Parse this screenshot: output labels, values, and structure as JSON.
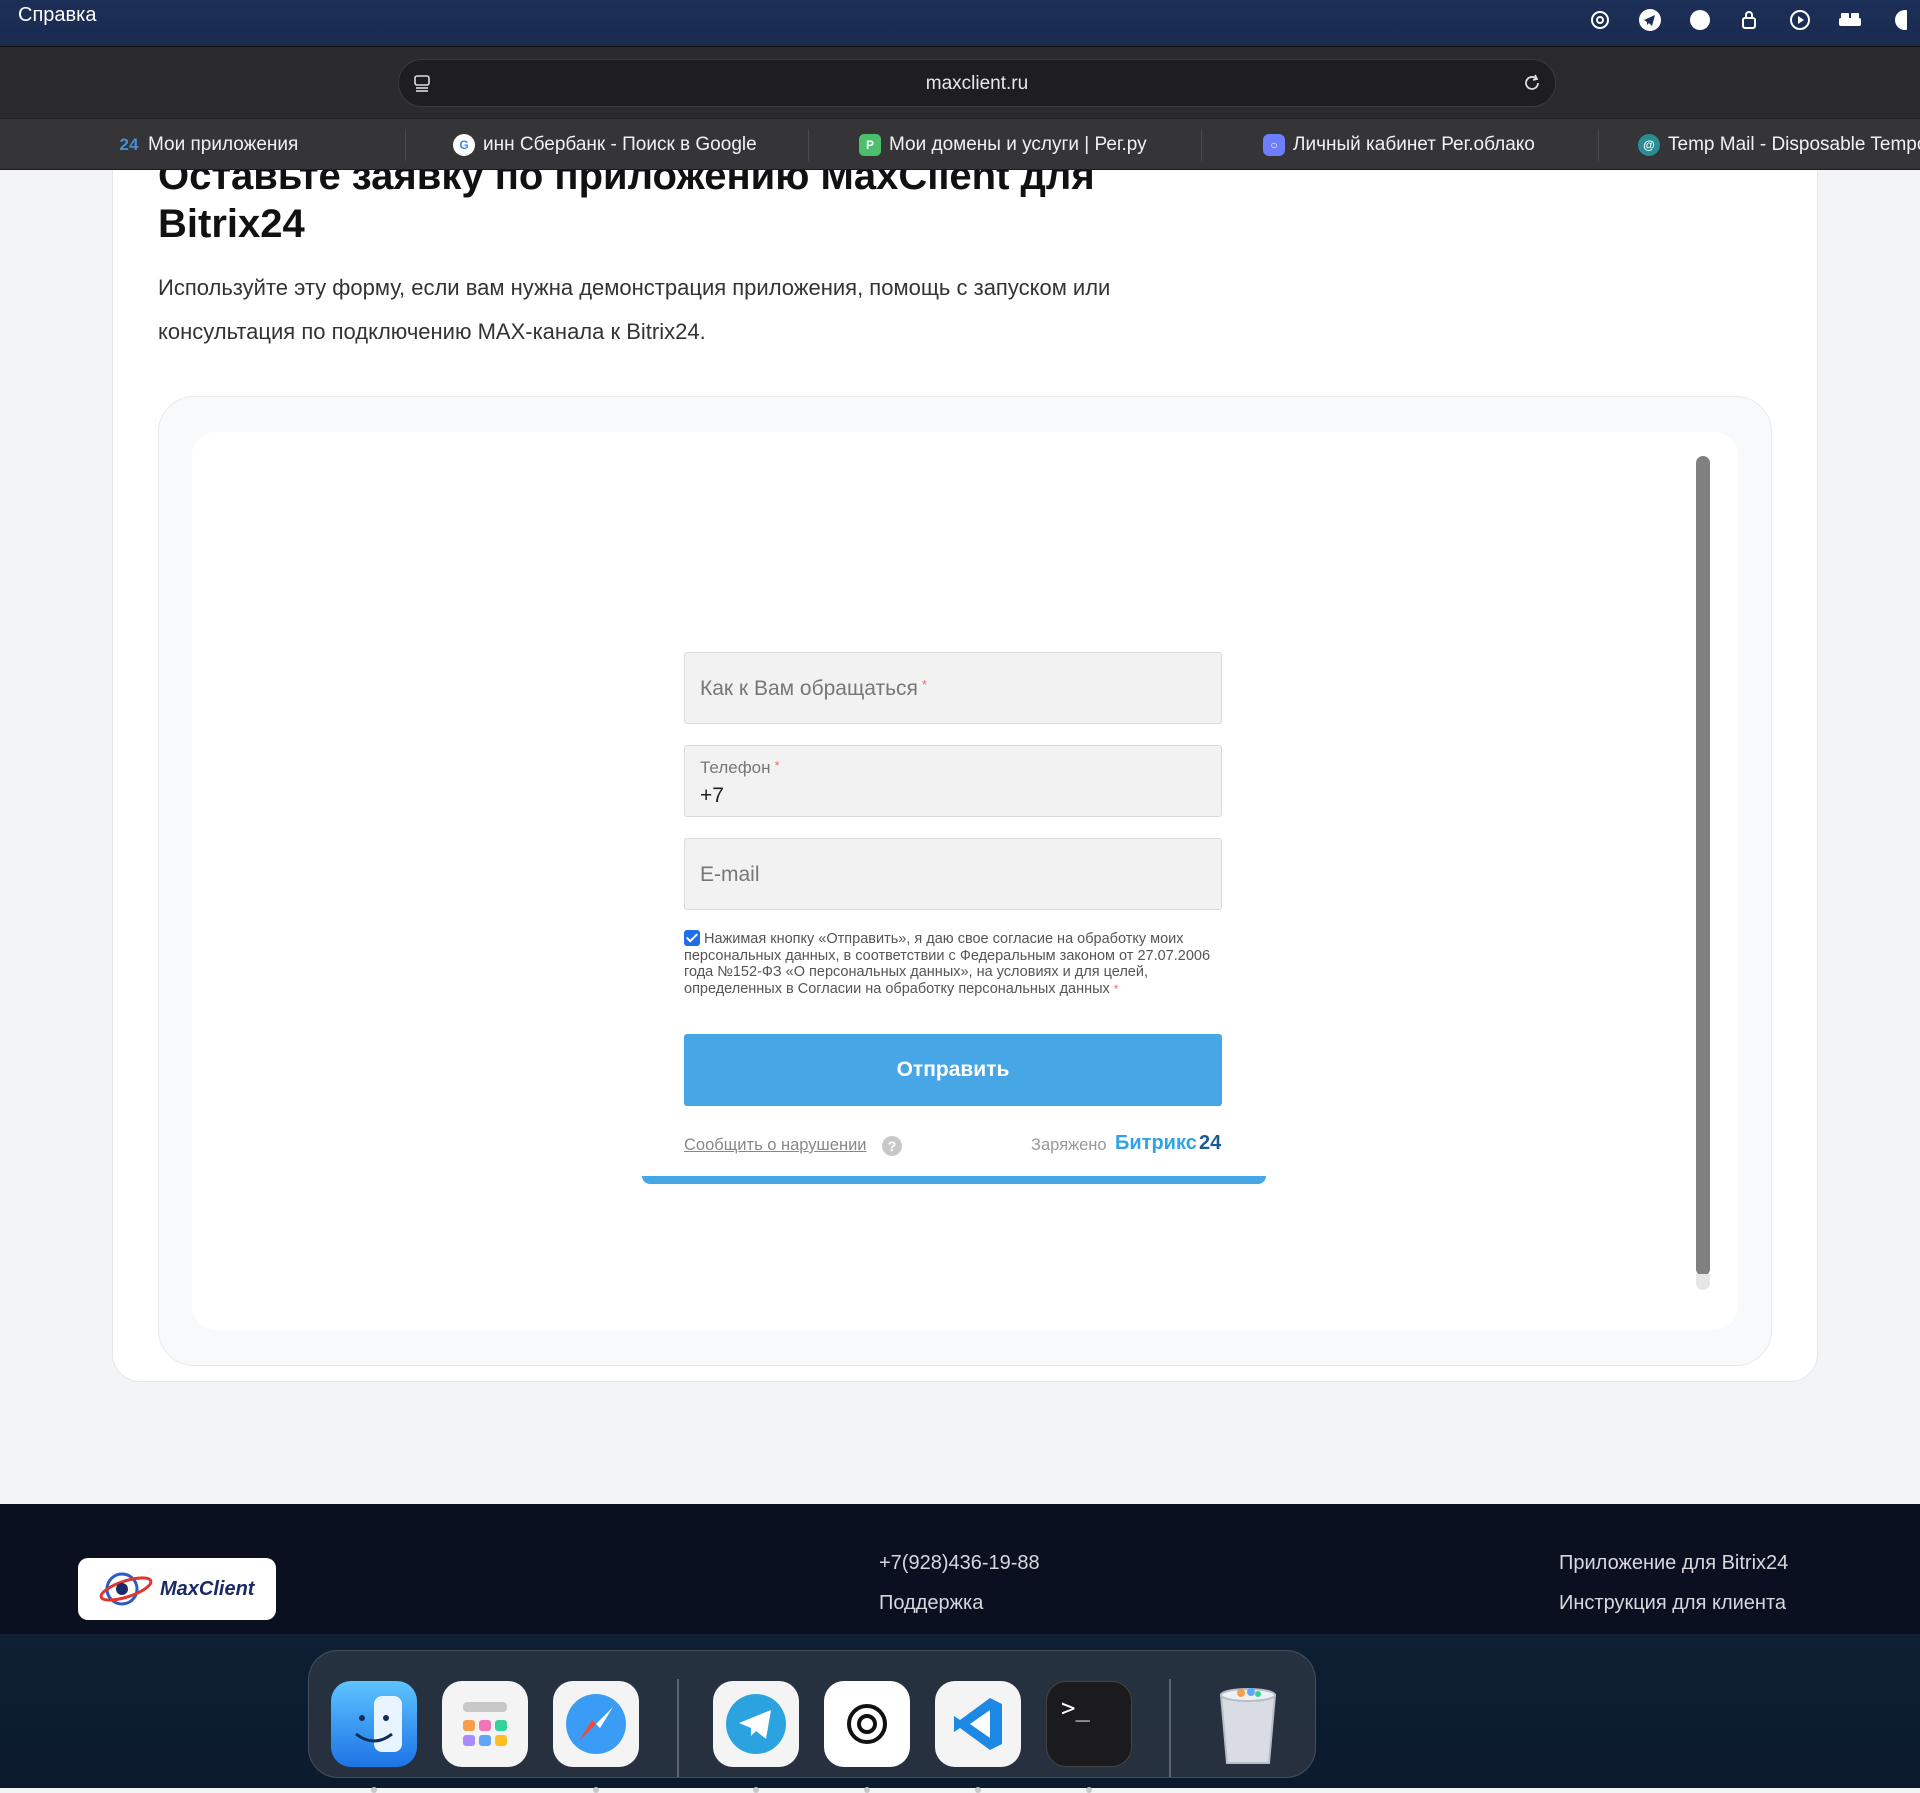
{
  "menubar": {
    "app_menu": "Справка"
  },
  "browser": {
    "url": "maxclient.ru"
  },
  "bookmarks": [
    {
      "label": "Мои приложения"
    },
    {
      "label": "инн Сбербанк - Поиск в Google"
    },
    {
      "label": "Мои домены и услуги | Рег.ру"
    },
    {
      "label": "Личный кабинет Рег.облако"
    },
    {
      "label": "Temp Mail - Disposable Tempo"
    }
  ],
  "page": {
    "heading_line1": "Оставьте заявку по приложению MaxClient для",
    "heading_line2": "Bitrix24",
    "lead": "Используйте эту форму, если вам нужна демонстрация приложения, помощь с запуском или консультация по подключению MAX-канала к Bitrix24."
  },
  "form": {
    "name_placeholder": "Как к Вам обращаться",
    "phone_label": "Телефон",
    "phone_value": "+7",
    "email_placeholder": "E-mail",
    "required_mark": "*",
    "consent_text": "Нажимая кнопку «Отправить», я даю свое согласие на обработку моих персональных данных, в соответствии с Федеральным законом от 27.07.2006 года №152-ФЗ «О персональных данных», на условиях и для целей, определенных в Согласии на обработку персональных данных",
    "consent_checked": true,
    "submit_label": "Отправить",
    "report_link": "Сообщить о нарушении",
    "help_glyph": "?",
    "charged_by": "Заряжено",
    "brand_name": "Битрикс",
    "brand_number": "24"
  },
  "footer": {
    "logo_text": "MaxClient",
    "phone": "+7(928)436-19-88",
    "support": "Поддержка",
    "link_app": "Приложение для Bitrix24",
    "link_instructions": "Инструкция для клиента"
  },
  "dock": {
    "apps": [
      "finder-icon",
      "launchpad-icon",
      "safari-icon",
      "telegram-icon",
      "chatgpt-icon",
      "vscode-icon",
      "terminal-icon",
      "trash-icon"
    ],
    "terminal_glyph": ">_"
  },
  "colors": {
    "submit": "#47a6e6",
    "brand_blue": "#2fa3e6",
    "footer_bg": "#0b1020"
  }
}
